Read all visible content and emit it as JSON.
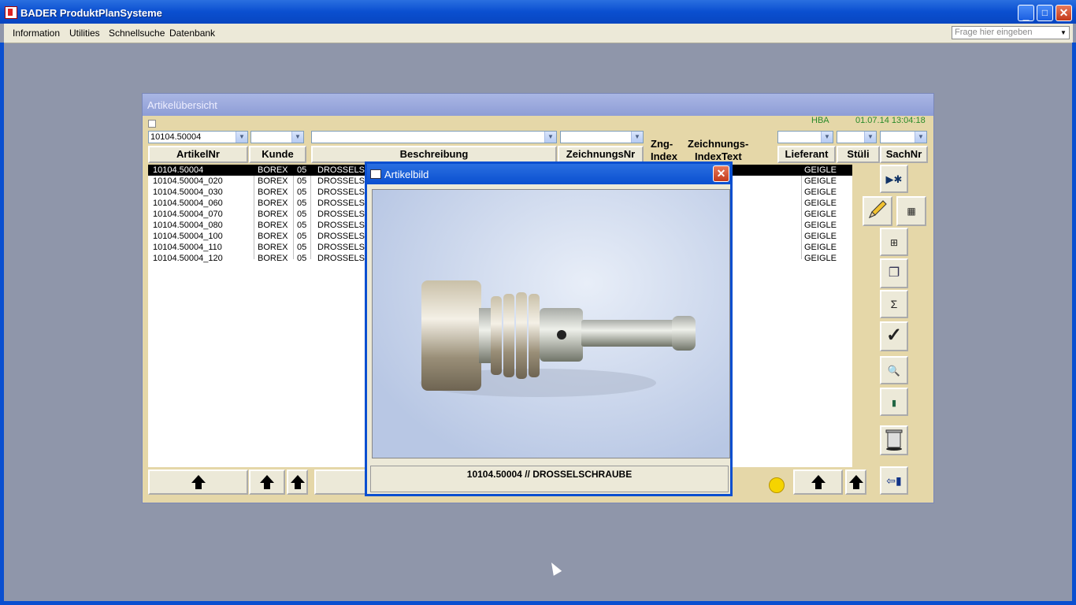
{
  "app": {
    "title": "BADER ProduktPlanSysteme"
  },
  "menubar": {
    "items": [
      "Information",
      "Utilities",
      "Schnellsuche",
      "Datenbank"
    ],
    "ask_placeholder": "Frage hier eingeben"
  },
  "artikel_window": {
    "title": "Artikelübersicht",
    "user": "HBA",
    "datetime": "01.07.14 13:04:18",
    "filters": {
      "artikelnr": "10104.50004",
      "kunde": "",
      "beschreibung": "",
      "zeichnungsnr": "",
      "lieferant": "",
      "stueli": "",
      "sachnr": ""
    },
    "headers": {
      "artikelnr": "ArtikelNr",
      "kunde": "Kunde",
      "beschreibung": "Beschreibung",
      "zeichnungsnr": "ZeichnungsNr",
      "zng_index_1": "Zng-",
      "zng_index_2": "Index",
      "zeichnungs_indextext_1": "Zeichnungs-",
      "zeichnungs_indextext_2": "IndexText",
      "lieferant": "Lieferant",
      "stueli": "Stüli",
      "sachnr": "SachNr"
    },
    "rows": [
      {
        "artikelnr": "10104.50004",
        "kunde": "BOREX",
        "code": "05",
        "beschreibung": "DROSSELSC",
        "lieferant": "GEIGLE"
      },
      {
        "artikelnr": "10104.50004_020",
        "kunde": "BOREX",
        "code": "05",
        "beschreibung": "DROSSELSC",
        "lieferant": "GEIGLE"
      },
      {
        "artikelnr": "10104.50004_030",
        "kunde": "BOREX",
        "code": "05",
        "beschreibung": "DROSSELSC",
        "lieferant": "GEIGLE"
      },
      {
        "artikelnr": "10104.50004_060",
        "kunde": "BOREX",
        "code": "05",
        "beschreibung": "DROSSELSC",
        "lieferant": "GEIGLE"
      },
      {
        "artikelnr": "10104.50004_070",
        "kunde": "BOREX",
        "code": "05",
        "beschreibung": "DROSSELSC",
        "lieferant": "GEIGLE"
      },
      {
        "artikelnr": "10104.50004_080",
        "kunde": "BOREX",
        "code": "05",
        "beschreibung": "DROSSELSC",
        "lieferant": "GEIGLE"
      },
      {
        "artikelnr": "10104.50004_100",
        "kunde": "BOREX",
        "code": "05",
        "beschreibung": "DROSSELSC",
        "lieferant": "GEIGLE"
      },
      {
        "artikelnr": "10104.50004_110",
        "kunde": "BOREX",
        "code": "05",
        "beschreibung": "DROSSELSC",
        "lieferant": "GEIGLE"
      },
      {
        "artikelnr": "10104.50004_120",
        "kunde": "BOREX",
        "code": "05",
        "beschreibung": "DROSSELSC",
        "lieferant": "GEIGLE"
      }
    ],
    "sidebar_icons": [
      "play-star-icon",
      "pencil-icon",
      "calculator-icon",
      "hierarchy-icon",
      "copy-pages-icon",
      "sigma-icon",
      "checkmark-icon",
      "print-preview-icon",
      "book-icon",
      "trash-icon",
      "exit-door-icon"
    ],
    "sigma_glyph": "Σ",
    "check_glyph": "✓"
  },
  "artikelbild_dialog": {
    "title": "Artikelbild",
    "caption": "10104.50004  //   DROSSELSCHRAUBE"
  }
}
